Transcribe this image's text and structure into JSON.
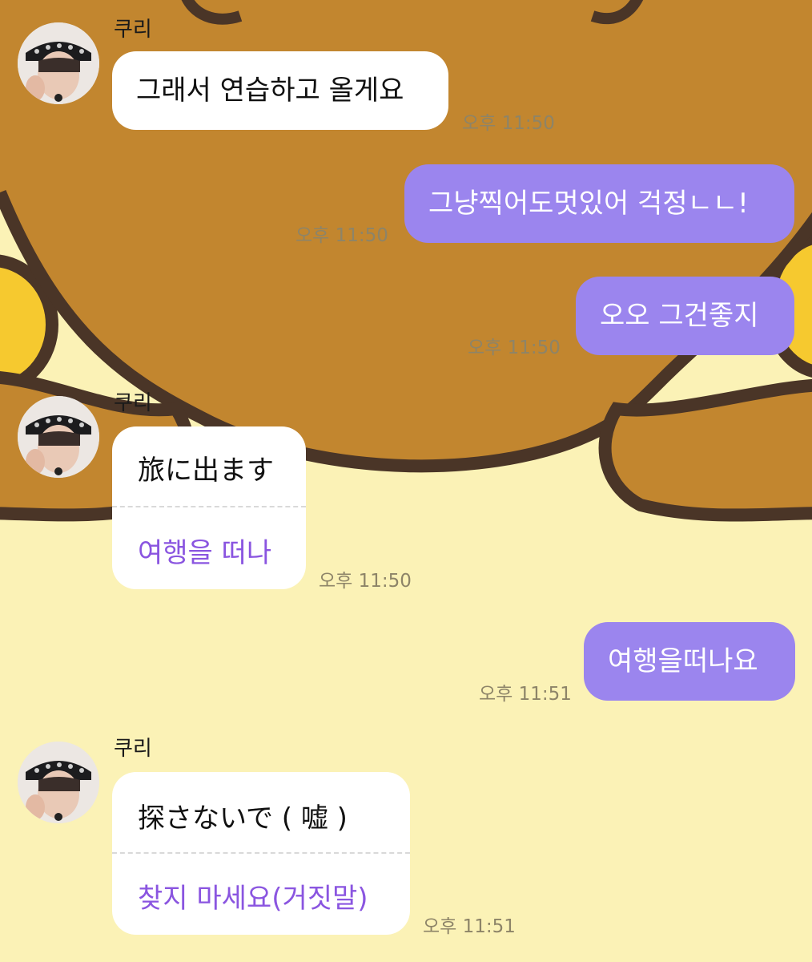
{
  "colors": {
    "sent_bubble": "#9b85ee",
    "received_bubble": "#ffffff",
    "translation_text": "#8a55e0",
    "wallpaper_brown": "#c2862f",
    "wallpaper_yellow": "#fbf2b6"
  },
  "messages": [
    {
      "sender": "쿠리",
      "text": "그래서 연습하고 올게요",
      "time": "오후 11:50"
    },
    {
      "text": "그냥찍어도멋있어 걱정ㄴㄴ!",
      "time": "오후 11:50"
    },
    {
      "text": "오오 그건좋지",
      "time": "오후 11:50"
    },
    {
      "sender": "쿠리",
      "text": "旅に出ます",
      "translation": "여행을 떠나",
      "time": "오후 11:50"
    },
    {
      "text": "여행을떠나요",
      "time": "오후 11:51"
    },
    {
      "sender": "쿠리",
      "text": "探さないで ( 嘘 )",
      "translation": "찾지 마세요(거짓말)",
      "time": "오후 11:51"
    }
  ]
}
